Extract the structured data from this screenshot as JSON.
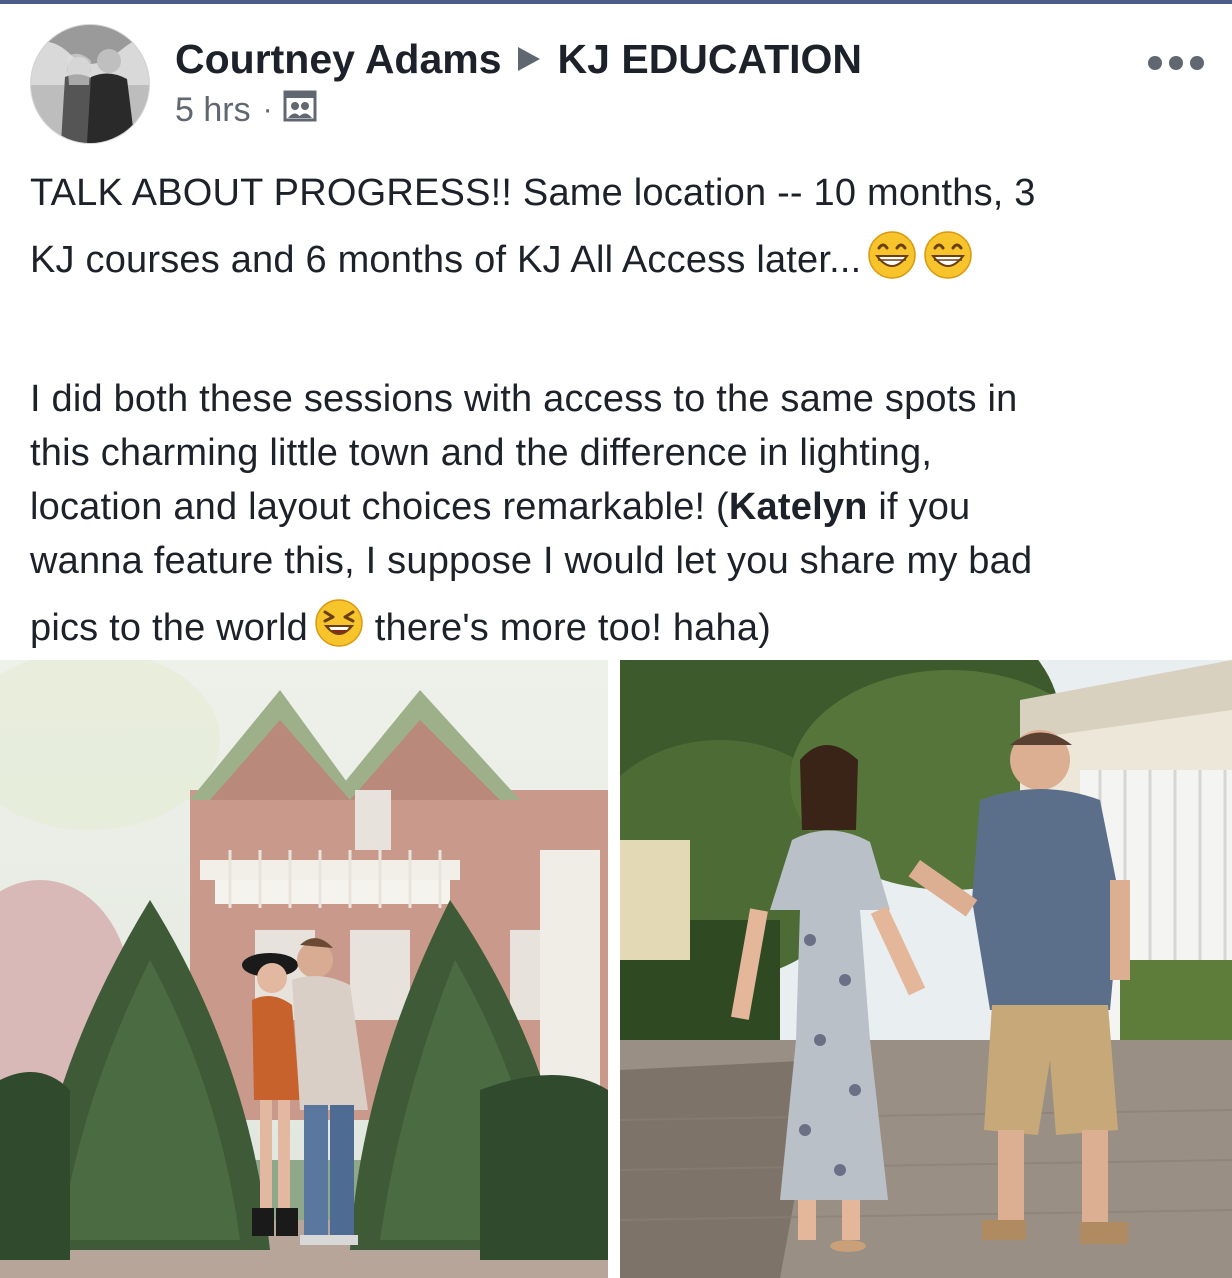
{
  "post": {
    "author": "Courtney Adams",
    "group": "KJ EDUCATION",
    "time": "5 hrs",
    "audience_icon": "group-audience-icon",
    "more_icon": "more-options-icon",
    "text": {
      "line1": "TALK ABOUT PROGRESS!!  Same location -- 10 months, 3",
      "line2": "KJ courses and 6 months of KJ All Access later...",
      "line3": "I did both these sessions with access to the same spots in",
      "line4": "this charming little town and the difference in lighting,",
      "line5": "location and layout choices remarkable! (",
      "mention": "Katelyn",
      "line5b": " if you",
      "line6": "wanna feature this, I suppose I would let you share my bad",
      "line7a": "pics to the world",
      "line7b": " there's more too! haha)"
    },
    "emojis": [
      "grinning-face-emoji",
      "grinning-face-emoji",
      "laughing-squinting-face-emoji"
    ],
    "photos": [
      {
        "name": "photo-couple-hug-by-trees"
      },
      {
        "name": "photo-couple-walking-hand-in-hand"
      }
    ]
  },
  "colors": {
    "text": "#1d2129",
    "meta": "#606770",
    "top_border": "#4b5b8a"
  }
}
